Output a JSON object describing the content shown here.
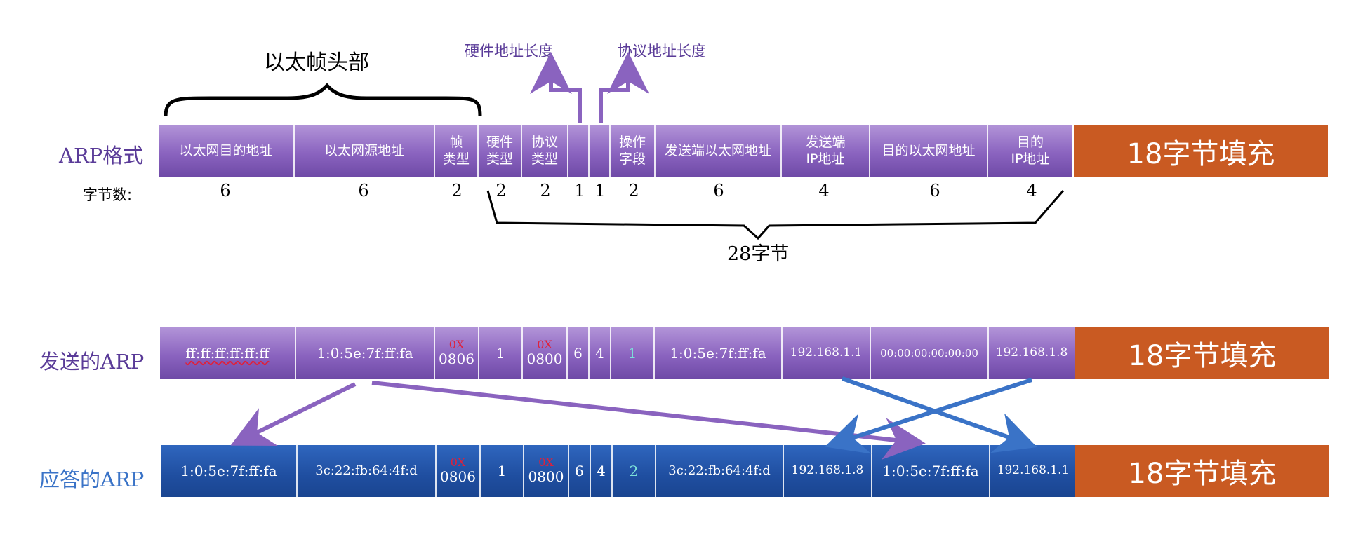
{
  "title": "以太帧头部",
  "annotations": {
    "hw_addr_len": "硬件地址长度",
    "proto_addr_len": "协议地址长度"
  },
  "total_bytes_label": "28字节",
  "bytes_row_label": "字节数:",
  "padding_label": "18字节填充",
  "format_row": {
    "label": "ARP格式",
    "cells": [
      "以太网目的地址",
      "以太网源地址",
      "帧\n类型",
      "硬件\n类型",
      "协议\n类型",
      "",
      "",
      "操作\n字段",
      "发送端以太网地址",
      "发送端\nIP地址",
      "目的以太网地址",
      "目的\nIP地址"
    ]
  },
  "byte_counts": [
    "6",
    "6",
    "2",
    "2",
    "2",
    "1",
    "1",
    "2",
    "6",
    "4",
    "6",
    "4"
  ],
  "request_row": {
    "label": "发送的ARP",
    "cells": [
      "ff:ff:ff:ff:ff:ff",
      "1:0:5e:7f:ff:fa",
      "0806",
      "1",
      "0800",
      "6",
      "4",
      "1",
      "1:0:5e:7f:ff:fa",
      "192.168.1.1",
      "00:00:00:00:00:00",
      "192.168.1.8"
    ]
  },
  "reply_row": {
    "label": "应答的ARP",
    "cells": [
      "1:0:5e:7f:ff:fa",
      "3c:22:fb:64:4f:d",
      "0806",
      "1",
      "0800",
      "6",
      "4",
      "2",
      "3c:22:fb:64:4f:d",
      "192.168.1.8",
      "1:0:5e:7f:ff:fa",
      "192.168.1.1"
    ]
  },
  "hex_prefix": "0X",
  "colors": {
    "purple": "#8a63bf",
    "blue": "#1f4ea0",
    "orange": "#c95a22",
    "purple_text": "#5a3b98",
    "blue_text": "#3a73c7",
    "arrow_purple": "#8a63bf",
    "arrow_blue": "#3a73c7"
  }
}
